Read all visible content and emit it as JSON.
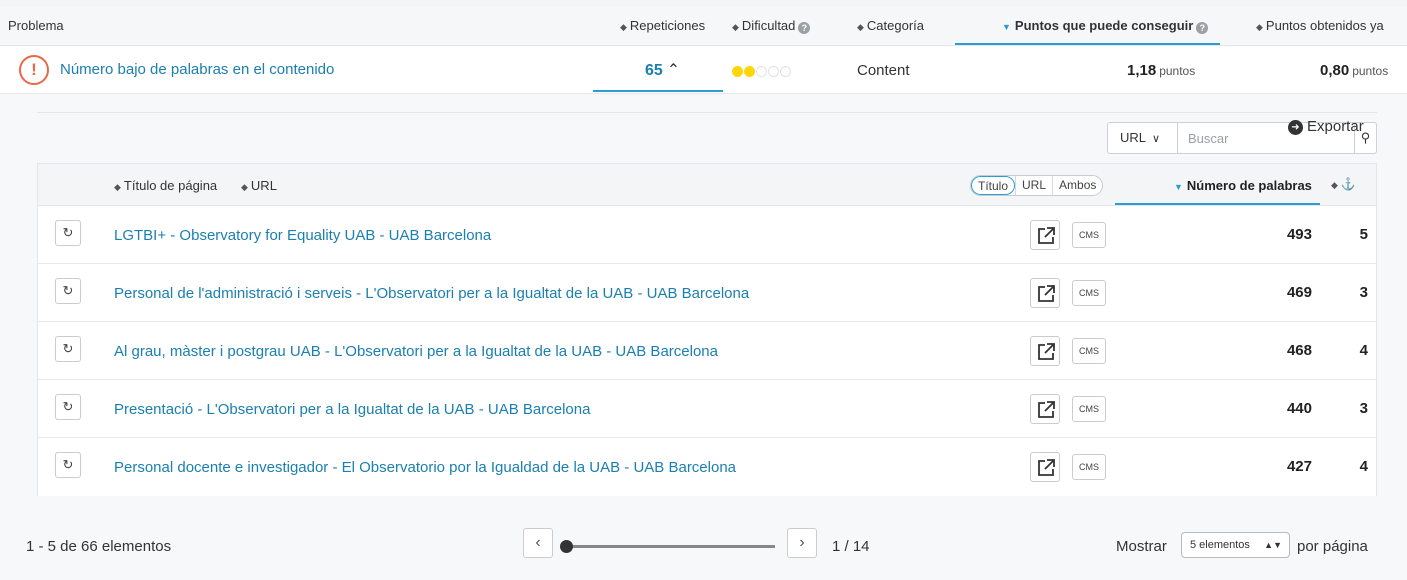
{
  "header": {
    "problem": "Problema",
    "repetitions": "Repeticiones",
    "difficulty": "Dificultad",
    "category": "Categoría",
    "points_available": "Puntos que puede conseguir",
    "points_obtained": "Puntos obtenidos ya"
  },
  "issue": {
    "title": "Número bajo de palabras en el contenido",
    "repetitions": "65",
    "difficulty_level": 2,
    "difficulty_max": 5,
    "category": "Content",
    "points_available_value": "1,18",
    "points_obtained_value": "0,80",
    "points_unit": "puntos",
    "alert_symbol": "!"
  },
  "toolbar": {
    "export_label": "Exportar",
    "search_scope": "URL",
    "search_placeholder": "Buscar"
  },
  "table": {
    "col_title": "Título de página",
    "col_url": "URL",
    "toggle": [
      "Título",
      "URL",
      "Ambos"
    ],
    "toggle_active": "Título",
    "col_words": "Número de palabras",
    "cms_label": "CMS",
    "rows": [
      {
        "title": "LGTBI+ - Observatory for Equality UAB - UAB Barcelona",
        "words": "493",
        "depth": "5"
      },
      {
        "title": "Personal de l'administració i serveis - L'Observatori per a la Igualtat de la UAB - UAB Barcelona",
        "words": "469",
        "depth": "3"
      },
      {
        "title": "Al grau, màster i postgrau UAB - L'Observatori per a la Igualtat de la UAB - UAB Barcelona",
        "words": "468",
        "depth": "4"
      },
      {
        "title": "Presentació - L'Observatori per a la Igualtat de la UAB - UAB Barcelona",
        "words": "440",
        "depth": "3"
      },
      {
        "title": "Personal docente e investigador - El Observatorio por la Igualdad de la UAB - UAB Barcelona",
        "words": "427",
        "depth": "4"
      }
    ]
  },
  "pagination": {
    "count_text": "1 - 5 de 66 elementos",
    "current_page": 1,
    "total_pages": 14,
    "page_text": "1 / 14",
    "show_label": "Mostrar",
    "per_page_option": "5 elementos",
    "per_page_suffix": "por página"
  },
  "colors": {
    "accent": "#2a9ed3",
    "link": "#1b7fb0",
    "alert": "#e8684a",
    "difficulty_on": "#ffd60a"
  }
}
